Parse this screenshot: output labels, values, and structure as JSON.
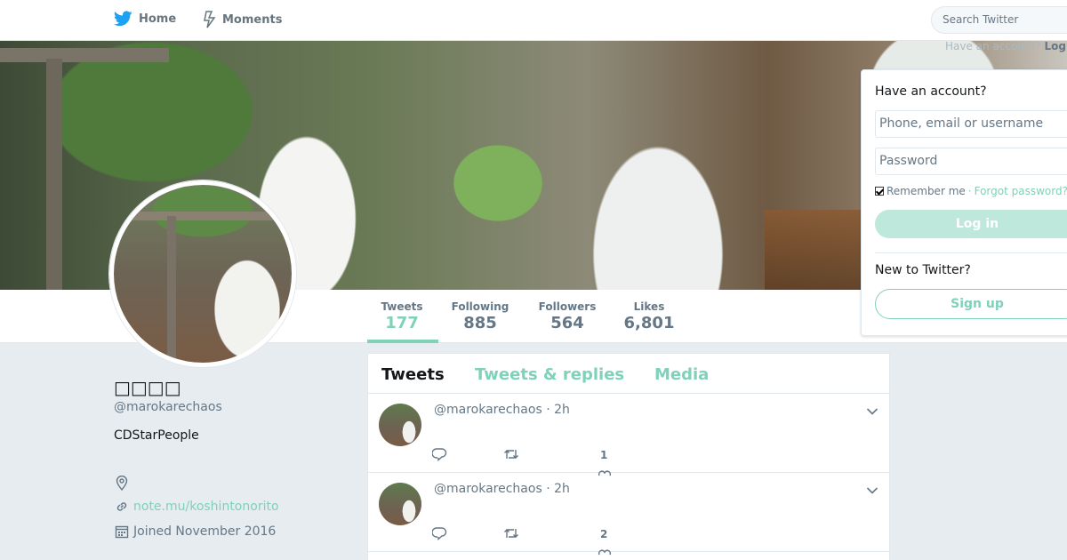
{
  "nav": {
    "home_label": "Home",
    "moments_label": "Moments",
    "search_placeholder": "Search Twitter",
    "accent_color": "#1da1f2"
  },
  "login": {
    "top_text": "Have an account?",
    "top_login": "Log",
    "heading": "Have an account?",
    "username_placeholder": "Phone, email or username",
    "password_placeholder": "Password",
    "remember_label": "Remember me",
    "forgot_label": "Forgot password?",
    "login_button": "Log in",
    "new_heading": "New to Twitter?",
    "signup_button": "Sign up"
  },
  "profile": {
    "name": "□□□□",
    "handle": "@marokarechaos",
    "bio": "CDStarPeople",
    "url": "note.mu/koshintonorito",
    "joined": "Joined November 2016"
  },
  "stats": [
    {
      "label": "Tweets",
      "value": "177"
    },
    {
      "label": "Following",
      "value": "885"
    },
    {
      "label": "Followers",
      "value": "564"
    },
    {
      "label": "Likes",
      "value": "6,801"
    }
  ],
  "timeline": {
    "tabs": [
      "Tweets",
      "Tweets & replies",
      "Media"
    ],
    "tweets": [
      {
        "header": "@marokarechaos · 2h",
        "likes": "1"
      },
      {
        "header": "@marokarechaos · 2h",
        "likes": "2"
      }
    ]
  },
  "colors": {
    "accent": "#7fd1b9",
    "background": "#e6ecf0"
  }
}
